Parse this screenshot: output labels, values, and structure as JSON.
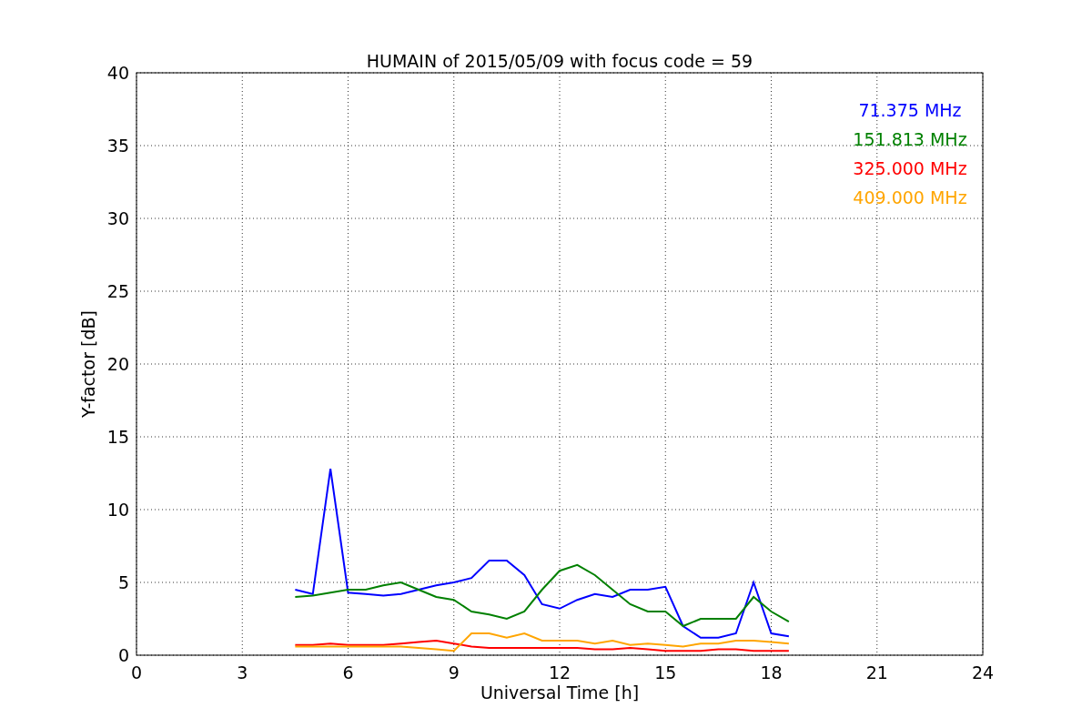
{
  "figure": {
    "chart_data": {
      "type": "line",
      "title": "HUMAIN of 2015/05/09 with focus code = 59",
      "xlabel": "Universal Time [h]",
      "ylabel": "Y-factor [dB]",
      "x": [
        4.5,
        5,
        5.5,
        6,
        6.5,
        7,
        7.5,
        8,
        8.5,
        9,
        9.5,
        10,
        10.5,
        11,
        11.5,
        12,
        12.5,
        13,
        13.5,
        14,
        14.5,
        15,
        15.5,
        16,
        16.5,
        17,
        17.5,
        18,
        18.5
      ],
      "series": [
        {
          "name": "71.375 MHz",
          "color": "#0000ff",
          "values": [
            4.5,
            4.2,
            12.8,
            4.3,
            4.2,
            4.1,
            4.2,
            4.5,
            4.8,
            5.0,
            5.3,
            6.5,
            6.5,
            5.5,
            3.5,
            3.2,
            3.8,
            4.2,
            4.0,
            4.5,
            4.5,
            4.7,
            2.0,
            1.2,
            1.2,
            1.5,
            5.0,
            1.5,
            1.3
          ]
        },
        {
          "name": "151.813 MHz",
          "color": "#008000",
          "values": [
            4.0,
            4.1,
            4.3,
            4.5,
            4.5,
            4.8,
            5.0,
            4.5,
            4.0,
            3.8,
            3.0,
            2.8,
            2.5,
            3.0,
            4.5,
            5.8,
            6.2,
            5.5,
            4.5,
            3.5,
            3.0,
            3.0,
            2.0,
            2.5,
            2.5,
            2.5,
            4.0,
            3.0,
            2.3
          ]
        },
        {
          "name": "325.000 MHz",
          "color": "#ff0000",
          "values": [
            0.7,
            0.7,
            0.8,
            0.7,
            0.7,
            0.7,
            0.8,
            0.9,
            1.0,
            0.8,
            0.6,
            0.5,
            0.5,
            0.5,
            0.5,
            0.5,
            0.5,
            0.4,
            0.4,
            0.5,
            0.4,
            0.3,
            0.3,
            0.3,
            0.4,
            0.4,
            0.3,
            0.3,
            0.3
          ]
        },
        {
          "name": "409.000 MHz",
          "color": "#ffa500",
          "values": [
            0.6,
            0.6,
            0.6,
            0.6,
            0.6,
            0.6,
            0.6,
            0.5,
            0.4,
            0.3,
            1.5,
            1.5,
            1.2,
            1.5,
            1.0,
            1.0,
            1.0,
            0.8,
            1.0,
            0.7,
            0.8,
            0.7,
            0.6,
            0.8,
            0.8,
            1.0,
            1.0,
            0.9,
            0.8
          ]
        }
      ],
      "xlim": [
        0,
        24
      ],
      "ylim": [
        0,
        40
      ],
      "xticks": [
        0,
        3,
        6,
        9,
        12,
        15,
        18,
        21,
        24
      ],
      "yticks": [
        0,
        5,
        10,
        15,
        20,
        25,
        30,
        35,
        40
      ],
      "grid": true
    }
  }
}
